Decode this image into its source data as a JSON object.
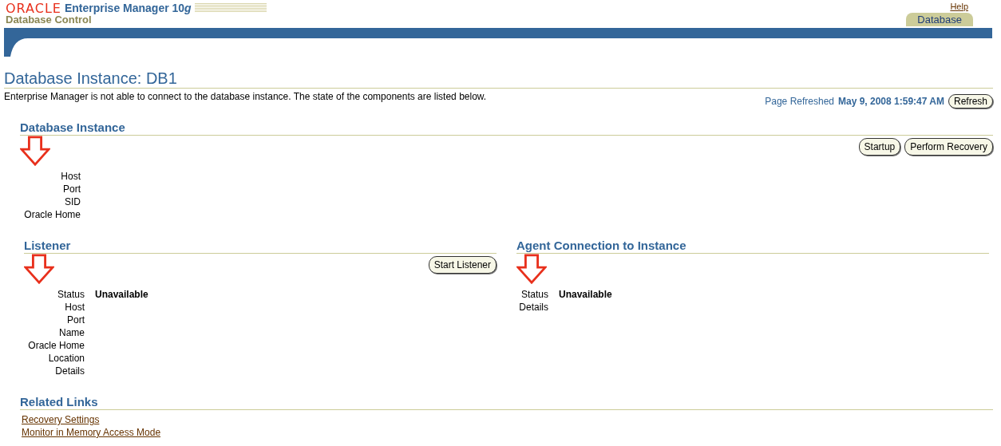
{
  "header": {
    "logo": "ORACLE",
    "product": "Enterprise Manager 10g",
    "subtitle": "Database Control",
    "help": "Help",
    "tabs": [
      {
        "label": "Database",
        "selected": true
      }
    ]
  },
  "page": {
    "title": "Database Instance: DB1",
    "message": "Enterprise Manager is not able to connect to the database instance. The state of the components are listed below.",
    "refreshed_label": "Page Refreshed",
    "refreshed_time": "May 9, 2008 1:59:47 AM",
    "refresh_button": "Refresh"
  },
  "database_instance": {
    "title": "Database Instance",
    "buttons": [
      "Startup",
      "Perform Recovery"
    ],
    "fields": [
      {
        "label": "Host"
      },
      {
        "label": "Port"
      },
      {
        "label": "SID"
      },
      {
        "label": "Oracle Home"
      }
    ]
  },
  "listener": {
    "title": "Listener",
    "buttons": [
      "Start Listener"
    ],
    "fields": [
      {
        "label": "Status",
        "value": "Unavailable"
      },
      {
        "label": "Host"
      },
      {
        "label": "Port"
      },
      {
        "label": "Name"
      },
      {
        "label": "Oracle Home"
      },
      {
        "label": "Location"
      },
      {
        "label": "Details"
      }
    ]
  },
  "agent_connection": {
    "title": "Agent Connection to Instance",
    "fields": [
      {
        "label": "Status",
        "value": "Unavailable"
      },
      {
        "label": "Details"
      }
    ]
  },
  "related_links": {
    "title": "Related Links",
    "links": [
      "Recovery Settings",
      "Monitor in Memory Access Mode"
    ]
  }
}
